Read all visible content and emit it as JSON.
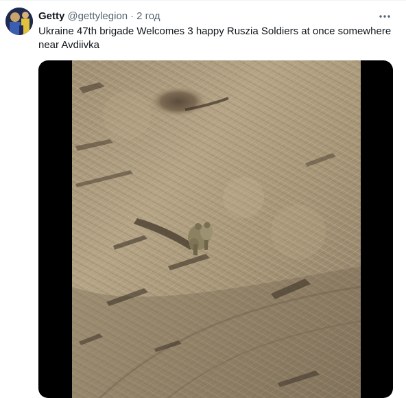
{
  "tweet": {
    "author": {
      "display_name": "Getty",
      "handle": "@gettylegion",
      "separator": "·",
      "time": "2 год",
      "avatar_icon": "avatar-image"
    },
    "text": "Ukraine 47th brigade Welcomes 3 happy Ruszia Soldiers at once somewhere near Avdiivka",
    "more_icon": "more-options-icon",
    "media": {
      "type": "video",
      "description_icon": "aerial-drone-video"
    }
  },
  "colors": {
    "text_primary": "#0f1419",
    "text_secondary": "#536471",
    "media_background": "#000000",
    "field_tone": "#a8977a"
  }
}
